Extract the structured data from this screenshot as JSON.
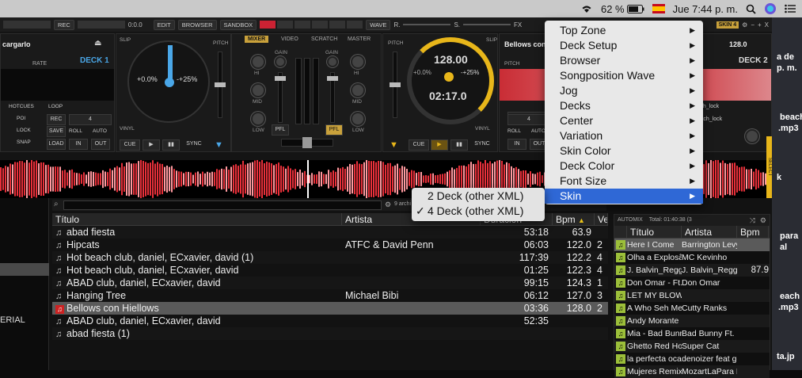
{
  "menubar": {
    "battery_pct": "62 %",
    "clock": "Jue 7:44 p. m.",
    "wifi_icon": "wifi-icon",
    "flag_icon": "spain-flag-icon"
  },
  "toolbar": {
    "rec_label": "REC",
    "time_value": "0:0.0",
    "edit_label": "EDIT",
    "browser_label": "BROWSER",
    "sandbox_label": "SANDBOX",
    "wave_label": "WAVE",
    "r_label": "R.",
    "s_label": "S.",
    "fx_label": "FX",
    "skin_label": "SKIN 4",
    "min_label": "−",
    "max_label": "+",
    "close_label": "X",
    "time_left": "00:00"
  },
  "deck1": {
    "title": "cargarlo",
    "rate_label": "RATE",
    "deck_label": "DECK 1",
    "slip_label": "SLIP",
    "pitch_label": "PITCH",
    "pitch_value": "+0.0%",
    "pitch_range": "-+25%",
    "vinyl_label": "VINYL",
    "hotcues_label": "HOTCUES",
    "loop_label": "LOOP",
    "poi_label": "POI",
    "lock_label": "LOCK",
    "snap_label": "SNAP",
    "rec_label": "REC",
    "save_label": "SAVE",
    "load_label": "LOAD",
    "loop_size": "4",
    "roll_label": "ROLL",
    "auto_label": "AUTO",
    "in_label": "IN",
    "out_label": "OUT",
    "cue_label": "CUE",
    "sync_label": "SYNC",
    "play_icon": "play-icon",
    "pause_icon": "pause-icon"
  },
  "mixer": {
    "tabs": [
      "MIXER",
      "VIDEO",
      "SCRATCH",
      "MASTER"
    ],
    "active_tab": "MIXER",
    "gain_label": "GAIN",
    "hi_label": "HI",
    "mid_label": "MID",
    "low_label": "LOW",
    "pfl_label": "PFL"
  },
  "deck2": {
    "title": "Bellows con",
    "bpm_display": "128.00",
    "time_display": "02:17.0",
    "pitch_value": "+0.0%",
    "pitch_range": "-+25%",
    "bpm": "128.0",
    "deck_label": "DECK 2",
    "pitch_label": "PITCH",
    "slip_label": "SLIP",
    "vinyl_label": "VINYL",
    "pitch_lock_label": "pitch_lock",
    "loop_size": "4",
    "roll_label": "ROLL",
    "auto_label": "AUTO",
    "in_label": "IN",
    "out_label": "OUT",
    "cue_label": "CUE",
    "sync_label": "SYNC"
  },
  "side_labels": {
    "select_top": "SELECT",
    "select_bottom": "SELECT"
  },
  "browser": {
    "search_placeholder": "",
    "files_count": "9 archi",
    "folder_item": "ERIAL",
    "columns": [
      "Título",
      "Artista",
      "Duración",
      "Bpm",
      "Ve"
    ],
    "rows": [
      {
        "title": "abad fiesta",
        "artist": "",
        "duration": "53:18",
        "bpm": "63.9",
        "ve": ""
      },
      {
        "title": "Hipcats",
        "artist": "ATFC & David Penn",
        "duration": "06:03",
        "bpm": "122.0",
        "ve": "2"
      },
      {
        "title": "Hot beach club, daniel, ECxavier, david (1)",
        "artist": "",
        "duration": "117:39",
        "bpm": "122.2",
        "ve": "4"
      },
      {
        "title": "Hot beach club, daniel, ECxavier, david",
        "artist": "",
        "duration": "01:25",
        "bpm": "122.3",
        "ve": "4"
      },
      {
        "title": "ABAD club, daniel, ECxavier, david",
        "artist": "",
        "duration": "99:15",
        "bpm": "124.3",
        "ve": "1"
      },
      {
        "title": "Hanging Tree",
        "artist": "Michael Bibi",
        "duration": "06:12",
        "bpm": "127.0",
        "ve": "3"
      },
      {
        "title": "Bellows con Hiellows",
        "artist": "",
        "duration": "03:36",
        "bpm": "128.0",
        "ve": "2"
      },
      {
        "title": "ABAD club, daniel, ECxavier, david",
        "artist": "",
        "duration": "52:35",
        "bpm": "",
        "ve": ""
      },
      {
        "title": "abad fiesta (1)",
        "artist": "",
        "duration": "",
        "bpm": "",
        "ve": ""
      }
    ]
  },
  "sidelist": {
    "title": "AUTOMIX",
    "total": "Total: 01:40:38 (3",
    "columns": [
      "Título",
      "Artista",
      "Bpm"
    ],
    "rows": [
      {
        "title": "Here I Come",
        "artist": "Barrington Levy",
        "bpm": ""
      },
      {
        "title": "Olha a Explosão",
        "artist": "MC Kevinho",
        "bpm": ""
      },
      {
        "title": "J. Balvin_Regg",
        "artist": "J. Balvin_Regg",
        "bpm": "87.9"
      },
      {
        "title": "Don Omar - Ft.",
        "artist": "Don Omar",
        "bpm": ""
      },
      {
        "title": "LET MY BLOW",
        "artist": "",
        "bpm": ""
      },
      {
        "title": "A Who Seh Me",
        "artist": "Cutty Ranks",
        "bpm": ""
      },
      {
        "title": "Andy Morante D",
        "artist": "",
        "bpm": ""
      },
      {
        "title": "Mia - Bad Bunny",
        "artist": "Bad Bunny Ft. D",
        "bpm": ""
      },
      {
        "title": "Ghetto Red Hot",
        "artist": "Super Cat",
        "bpm": ""
      },
      {
        "title": "la perfecta ocac",
        "artist": "denoizer feat go",
        "bpm": ""
      },
      {
        "title": "Mujeres Remix",
        "artist": "MozartLaPara F",
        "bpm": ""
      }
    ]
  },
  "desktop": {
    "labels": [
      "a de",
      "p. m.",
      "beach",
      ".mp3",
      "k",
      "para",
      "al",
      "each",
      ".mp3",
      "ta.jp"
    ]
  },
  "context_menu": {
    "items": [
      {
        "label": "Top Zone"
      },
      {
        "label": "Deck Setup"
      },
      {
        "label": "Browser"
      },
      {
        "label": "Songposition Wave"
      },
      {
        "label": "Jog"
      },
      {
        "label": "Decks"
      },
      {
        "label": "Center"
      },
      {
        "label": "Variation"
      },
      {
        "label": "Skin Color"
      },
      {
        "label": "Deck Color"
      },
      {
        "label": "Font Size"
      },
      {
        "label": "Skin"
      }
    ],
    "highlighted": "Skin",
    "arrow_glyph": "▶"
  },
  "submenu": {
    "items": [
      {
        "label": "2 Deck (other XML)",
        "checked": false
      },
      {
        "label": "4 Deck (other XML)",
        "checked": true
      }
    ],
    "check_glyph": "✓"
  },
  "colors": {
    "accent_gold": "#e8b61a",
    "accent_blue": "#4aa7e8",
    "menu_highlight": "#2f68d6",
    "wave_red": "#e8303a"
  }
}
